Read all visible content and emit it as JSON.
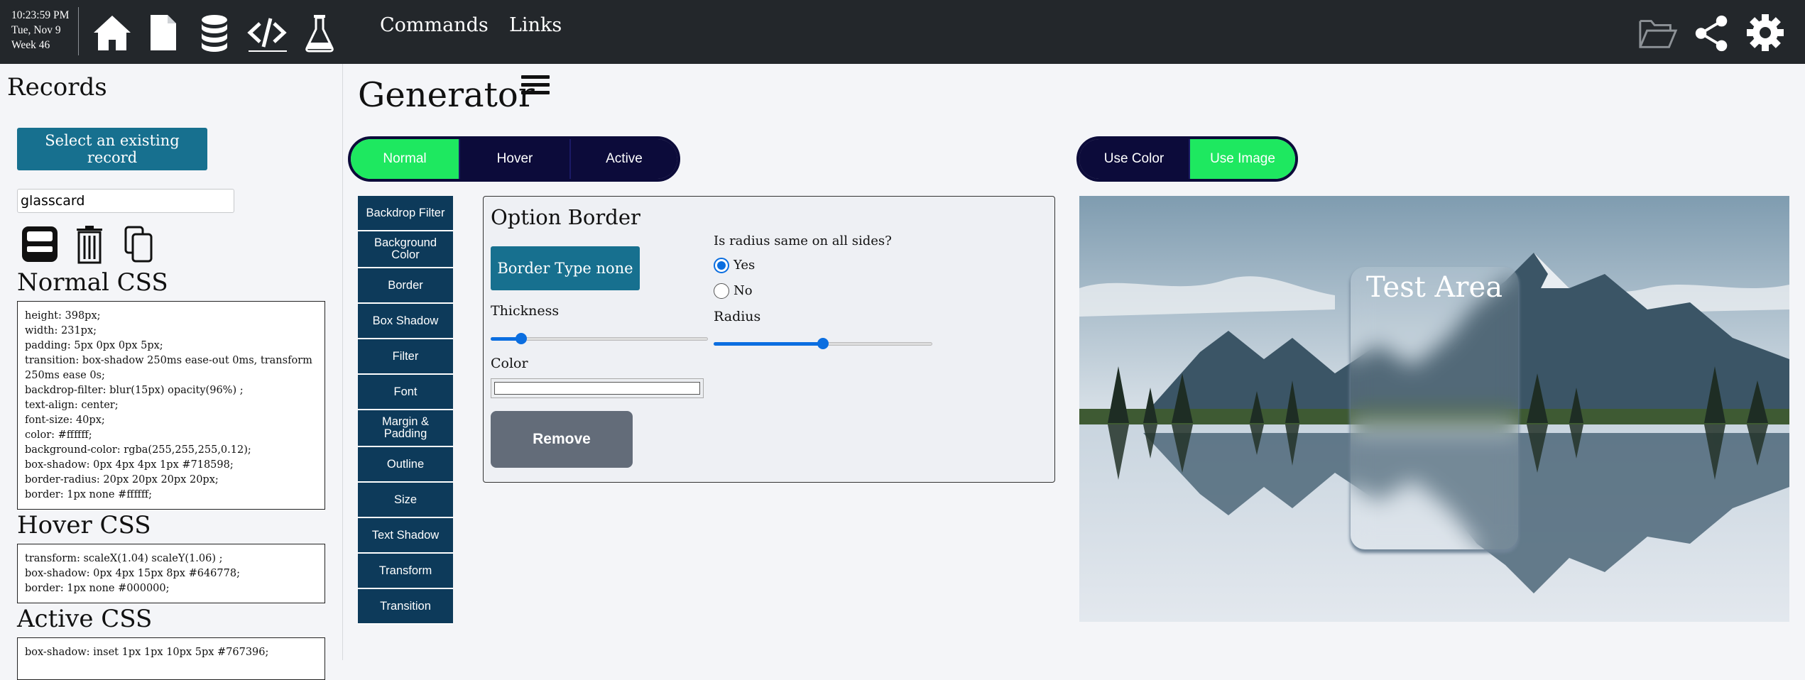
{
  "clock": {
    "time": "10:23:59 PM",
    "date": "Tue, Nov 9",
    "week": "Week 46"
  },
  "topnav": {
    "icons": [
      "home-icon",
      "document-icon",
      "database-icon",
      "code-icon",
      "flask-icon"
    ],
    "links": [
      "Commands",
      "Links"
    ],
    "right_icons": [
      "folder-open-icon",
      "share-icon",
      "gear-icon"
    ]
  },
  "sidebar": {
    "heading": "Records",
    "select_button": "Select an existing record",
    "record_name": "glasscard",
    "record_icons": [
      "save-icon",
      "trash-icon",
      "copy-icon"
    ],
    "normal_heading": "Normal CSS",
    "normal_css": [
      "height: 398px;",
      "width: 231px;",
      "padding: 5px 0px 0px 5px;",
      "transition: box-shadow 250ms ease-out 0ms, transform 250ms ease 0s;",
      "backdrop-filter: blur(15px) opacity(96%) ;",
      "text-align: center;",
      "font-size: 40px;",
      "color: #ffffff;",
      "background-color: rgba(255,255,255,0.12);",
      "box-shadow: 0px 4px 4px 1px #718598;",
      "border-radius: 20px 20px 20px 20px;",
      "border: 1px none #ffffff;"
    ],
    "hover_heading": "Hover CSS",
    "hover_css": [
      "transform: scaleX(1.04) scaleY(1.06) ;",
      "box-shadow: 0px 4px 15px 8px #646778;",
      "border: 1px none #000000;"
    ],
    "active_heading": "Active CSS",
    "active_css": [
      "box-shadow: inset 1px 1px 10px 5px #767396;"
    ]
  },
  "main": {
    "title": "Generator",
    "state_tabs": [
      {
        "label": "Normal",
        "active": true
      },
      {
        "label": "Hover",
        "active": false
      },
      {
        "label": "Active",
        "active": false
      }
    ],
    "bg_tabs": [
      {
        "label": "Use Color",
        "active": false
      },
      {
        "label": "Use Image",
        "active": true
      }
    ],
    "options": [
      "Backdrop Filter",
      "Background Color",
      "Border",
      "Box Shadow",
      "Filter",
      "Font",
      "Margin & Padding",
      "Outline",
      "Size",
      "Text Shadow",
      "Transform",
      "Transition"
    ],
    "panel": {
      "title": "Option Border",
      "border_type_button": "Border Type none",
      "thickness_label": "Thickness",
      "thickness_level": 0.14,
      "color_label": "Color",
      "color_value": "#ffffff",
      "remove_button": "Remove",
      "radius_question": "Is radius same on all sides?",
      "radius_yes": "Yes",
      "radius_no": "No",
      "radius_selected": "Yes",
      "radius_label": "Radius",
      "radius_level": 0.5
    },
    "preview": {
      "card_text": "Test Area"
    }
  },
  "colors": {
    "topbar": "#23272b",
    "accent_blue": "#17708f",
    "toggle_on": "#1ee860",
    "toggle_off": "#0c0b3a",
    "option_nav": "#0d3a5a",
    "slider": "#0b6ee0",
    "remove": "#636c79"
  }
}
